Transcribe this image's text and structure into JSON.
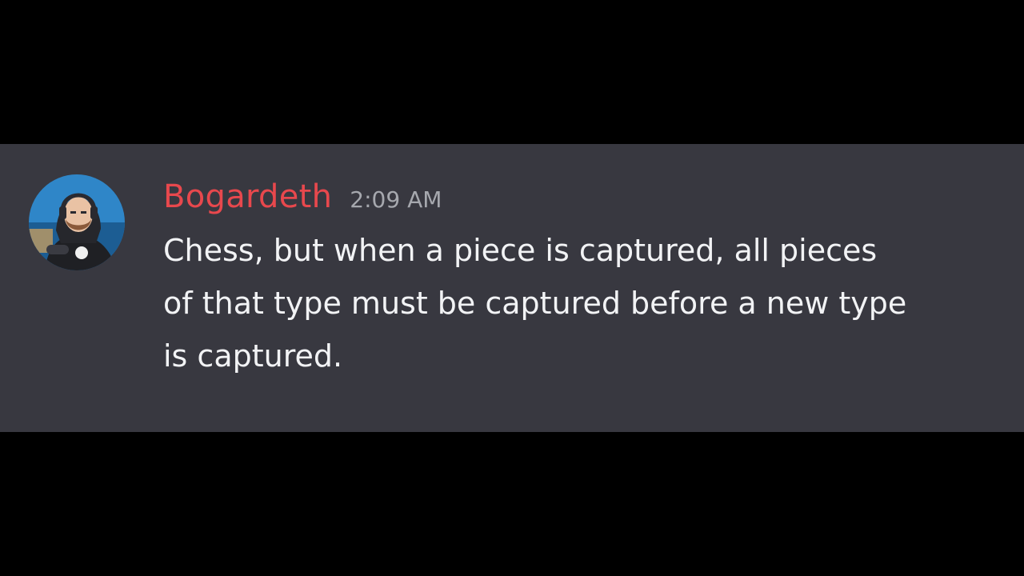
{
  "message": {
    "author": "Bogardeth",
    "timestamp": "2:09 AM",
    "lines": [
      "Chess, but when a piece is captured, all pieces",
      "of that type must be captured before a new type",
      "is captured."
    ]
  },
  "colors": {
    "background": "#000000",
    "panel": "#383840",
    "username": "#e8484d",
    "timestamp": "#a6a8ae",
    "text": "#f2f3f5"
  },
  "icons": {
    "avatar": "user-avatar-icon"
  }
}
